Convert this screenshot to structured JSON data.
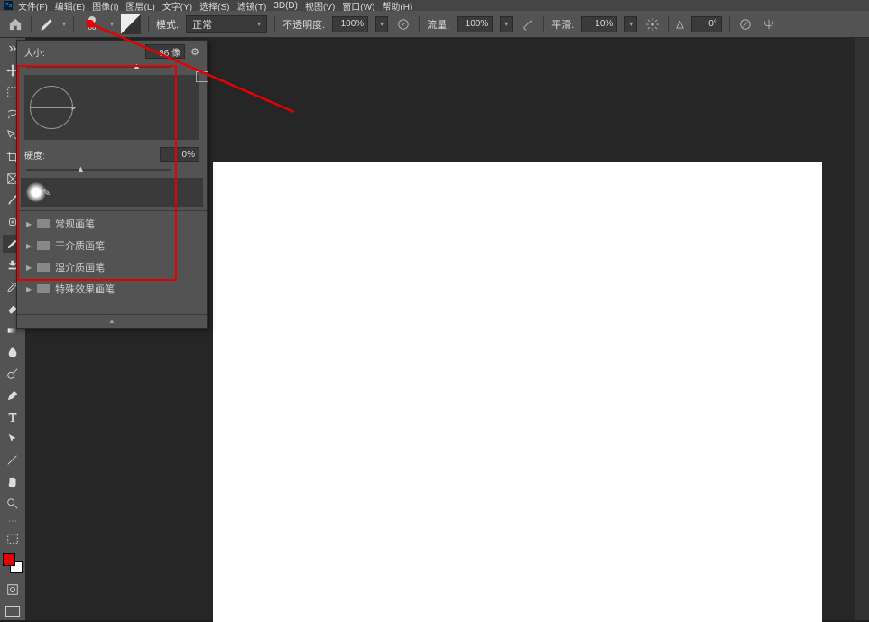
{
  "menubar": {
    "items": [
      "文件(F)",
      "编辑(E)",
      "图像(I)",
      "图层(L)",
      "文字(Y)",
      "选择(S)",
      "滤镜(T)",
      "3D(D)",
      "视图(V)",
      "窗口(W)",
      "帮助(H)"
    ]
  },
  "optbar": {
    "brush_size_num": "86",
    "mode_label": "模式:",
    "mode_value": "正常",
    "opacity_label": "不透明度:",
    "opacity_value": "100%",
    "flow_label": "流量:",
    "flow_value": "100%",
    "smoothing_label": "平滑:",
    "smoothing_value": "10%",
    "angle_icon": "△",
    "angle_value": "0°"
  },
  "brush_panel": {
    "size_label": "大小:",
    "size_value": "86 像",
    "hardness_label": "硬度:",
    "hardness_value": "0%",
    "folders": [
      "常规画笔",
      "干介质画笔",
      "湿介质画笔",
      "特殊效果画笔"
    ]
  },
  "swatches": {
    "fg": "#e60000",
    "bg": "#ffffff"
  }
}
